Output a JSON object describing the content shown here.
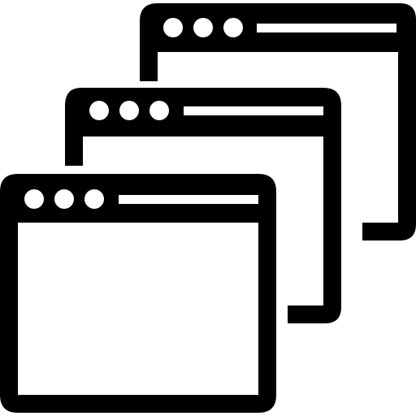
{
  "icon": {
    "name": "multiple-browser-windows-icon",
    "stroke_color": "#000000",
    "background_color": "#ffffff",
    "window_count": 3,
    "dots_per_titlebar": 3
  }
}
